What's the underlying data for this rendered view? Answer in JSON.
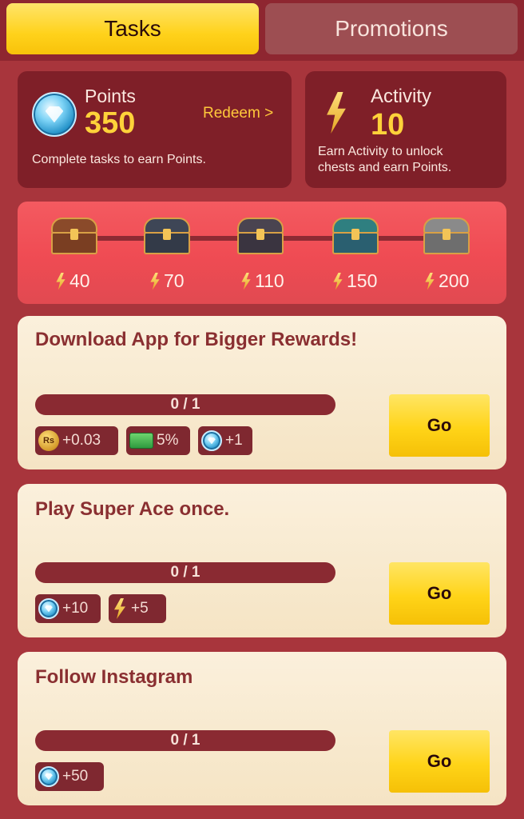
{
  "tabs": {
    "tasks": "Tasks",
    "promotions": "Promotions"
  },
  "points": {
    "label": "Points",
    "value": "350",
    "redeem": "Redeem >",
    "description": "Complete tasks to earn Points."
  },
  "activity": {
    "label": "Activity",
    "value": "10",
    "description_line1": "Earn Activity to unlock",
    "description_line2": "chests and earn Points."
  },
  "chests": [
    {
      "threshold": "40",
      "color": "brown"
    },
    {
      "threshold": "70",
      "color": "slate"
    },
    {
      "threshold": "110",
      "color": "black"
    },
    {
      "threshold": "150",
      "color": "teal"
    },
    {
      "threshold": "200",
      "color": "silver"
    }
  ],
  "tasks": [
    {
      "title": "Download App for Bigger Rewards!",
      "progress": "0 / 1",
      "go": "Go",
      "rewards": [
        "+0.03",
        "5%",
        "+1"
      ]
    },
    {
      "title": "Play Super Ace once.",
      "progress": "0 / 1",
      "go": "Go",
      "rewards": [
        "+10",
        "+5"
      ]
    },
    {
      "title": "Follow Instagram",
      "progress": "0 / 1",
      "go": "Go",
      "rewards": [
        "+50"
      ]
    }
  ],
  "icons": {
    "coin_text": "Rs"
  },
  "colors": {
    "background": "#a8353c",
    "accent_yellow": "#ffd21b",
    "dark_panel": "#7f1f28",
    "task_title": "#8a2f31"
  }
}
